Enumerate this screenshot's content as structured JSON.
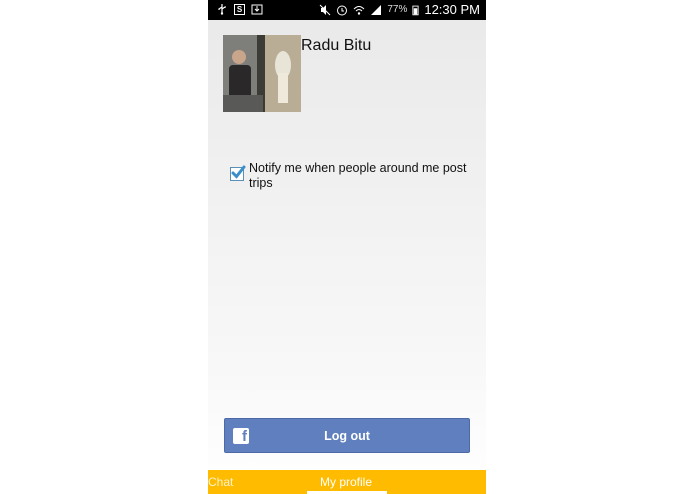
{
  "statusbar": {
    "icons_left": [
      "usb-icon",
      "skype-icon",
      "download-icon"
    ],
    "icons_right": [
      "mute-icon",
      "alarm-icon",
      "wifi-icon",
      "signal-icon"
    ],
    "battery": "77%",
    "time": "12:30 PM"
  },
  "profile": {
    "name": "Radu Bitu",
    "avatar_icon": "profile-photo"
  },
  "settings": {
    "notify_label": "Notify me when people around me post trips",
    "notify_checked": true
  },
  "logout": {
    "label": "Log out",
    "icon": "facebook-icon",
    "color": "#5f7fbf"
  },
  "tabs": [
    {
      "label": "Chat",
      "active": false
    },
    {
      "label": "My profile",
      "active": true
    }
  ],
  "colors": {
    "tabbar": "#ffbb00",
    "checkbox": "#3b8fc9"
  }
}
